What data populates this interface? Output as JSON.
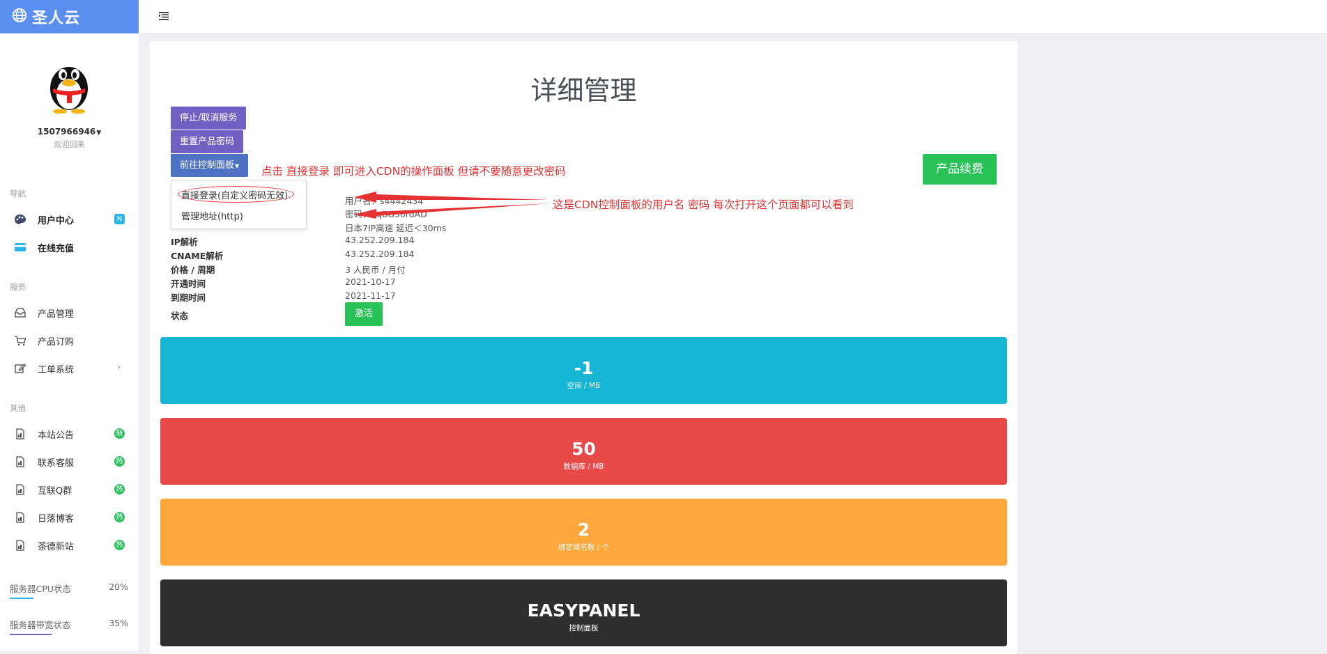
{
  "brand": {
    "name": "圣人云",
    "icon": "globe-icon"
  },
  "user": {
    "username": "1507966946",
    "welcome": "欢迎回来"
  },
  "sidebar": {
    "sections": [
      {
        "label": "导航",
        "items": [
          {
            "label": "用户中心",
            "icon": "palette-icon",
            "badge": "N"
          },
          {
            "label": "在线充值",
            "icon": "card-icon"
          }
        ]
      },
      {
        "label": "服务",
        "items": [
          {
            "label": "产品管理",
            "icon": "inbox-icon"
          },
          {
            "label": "产品订购",
            "icon": "cart-icon"
          },
          {
            "label": "工单系统",
            "icon": "edit-icon"
          }
        ]
      },
      {
        "label": "其他",
        "items": [
          {
            "label": "本站公告",
            "icon": "doc-icon",
            "badge": "新"
          },
          {
            "label": "联系客服",
            "icon": "doc-icon",
            "badge": "热"
          },
          {
            "label": "互联Q群",
            "icon": "doc-icon",
            "badge": "热"
          },
          {
            "label": "日落博客",
            "icon": "doc-icon",
            "badge": "热"
          },
          {
            "label": "茶德新站",
            "icon": "doc-icon",
            "badge": "热"
          }
        ]
      }
    ],
    "stats": [
      {
        "label": "服务器CPU状态",
        "value": "20%",
        "color": "#2ab5e8"
      },
      {
        "label": "服务器带宽状态",
        "value": "35%",
        "color": "#7360c3"
      }
    ]
  },
  "main": {
    "title": "详细管理",
    "buttons": {
      "stop": "停止/取消服务",
      "reset": "重置产品密码",
      "panel": "前往控制面板",
      "renew": "产品续费"
    },
    "dropdown": {
      "direct_login": "直接登录(自定义密码无效)",
      "manage_url": "管理地址(http)"
    },
    "notes": {
      "login_tip": "点击 直接登录 即可进入CDN的操作面板 但请不要随意更改密码",
      "account_tip": "这是CDN控制面板的用户名 密码 每次打开这个页面都可以看到"
    },
    "info": {
      "username": "用户名：s4442434",
      "password": "密码：vqBG36rdAD",
      "line": "日本7IP高速 延迟＜30ms",
      "rows": [
        {
          "label": "IP解析",
          "value": "43.252.209.184"
        },
        {
          "label": "CNAME解析",
          "value": "43.252.209.184"
        },
        {
          "label": "价格 / 周期",
          "value": "3 人民币 / 月付"
        },
        {
          "label": "开通时间",
          "value": "2021-10-17"
        },
        {
          "label": "到期时间",
          "value": "2021-11-17"
        }
      ],
      "status_label": "状态",
      "status_value": "激活"
    },
    "cards": [
      {
        "value": "-1",
        "label": "空间 / MB",
        "color": "#15b5d3"
      },
      {
        "value": "50",
        "label": "数据库 / MB",
        "color": "#e84a4a"
      },
      {
        "value": "2",
        "label": "绑定域名数 / 个",
        "color": "#fea73c"
      },
      {
        "value": "EASYPANEL",
        "label": "控制面板",
        "color": "#2f2f30"
      }
    ]
  }
}
